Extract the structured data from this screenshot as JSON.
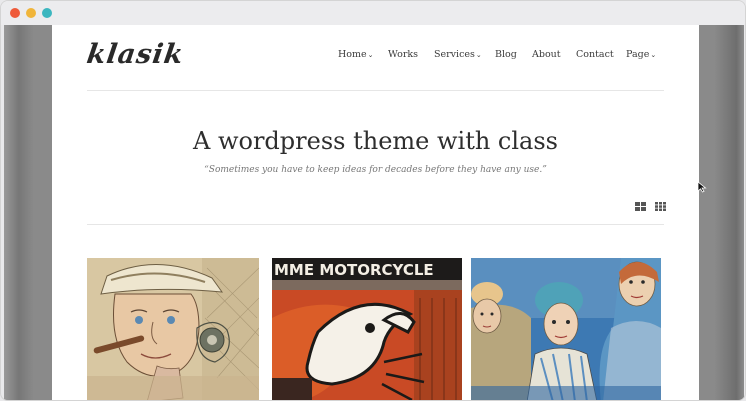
{
  "browser": {
    "dots": [
      "#ee5a3a",
      "#f0b53a",
      "#3bb6bf"
    ]
  },
  "site": {
    "logo": "klasik"
  },
  "nav": [
    {
      "label": "Home",
      "dropdown": true
    },
    {
      "label": "Works",
      "dropdown": false
    },
    {
      "label": "Services",
      "dropdown": true
    },
    {
      "label": "Blog",
      "dropdown": false
    },
    {
      "label": "About",
      "dropdown": false
    },
    {
      "label": "Contact",
      "dropdown": false
    },
    {
      "label": "Page",
      "dropdown": true
    }
  ],
  "hero": {
    "title": "A wordpress theme with class",
    "quote": "“Sometimes you have to keep ideas for decades before they have any use.”"
  },
  "gallery": {
    "view_toggles": [
      "grid-large-icon",
      "grid-small-icon"
    ],
    "items": [
      {
        "name": "portfolio-thumb-man-with-cigar"
      },
      {
        "name": "portfolio-thumb-motorcycle",
        "text": "MME MOTORCYCLE"
      },
      {
        "name": "portfolio-thumb-three-women"
      }
    ]
  }
}
